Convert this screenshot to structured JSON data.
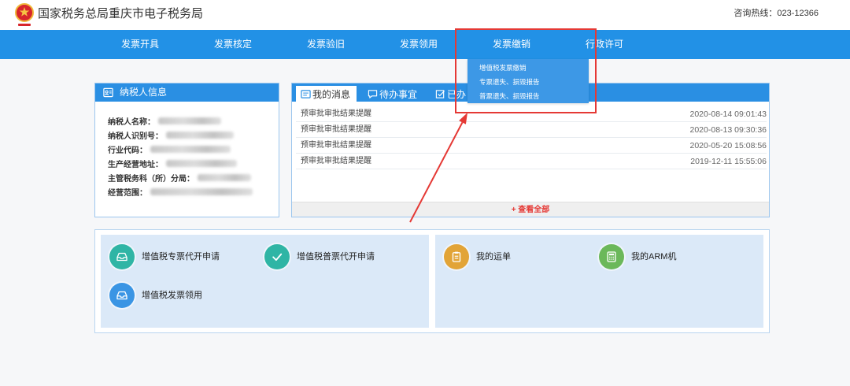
{
  "header": {
    "title": "国家税务总局重庆市电子税务局",
    "hotline": "咨询热线：023-12366",
    "logo_icon": "national-tax-emblem-icon"
  },
  "theme": {
    "nav_blue": "#2291e6",
    "dropdown_blue": "#3d98e6",
    "panel_header_blue": "#2a8fe3",
    "annotation_red": "#e53935",
    "view_all_red": "#e53935",
    "service_box_bg": "#dbe9f8"
  },
  "nav": {
    "items": [
      {
        "label": "发票开具"
      },
      {
        "label": "发票核定"
      },
      {
        "label": "发票验旧"
      },
      {
        "label": "发票领用"
      },
      {
        "label": "发票缴销",
        "active": true
      },
      {
        "label": "行政许可"
      }
    ]
  },
  "dropdown": {
    "items": [
      {
        "label": "增值税发票缴销"
      },
      {
        "label": "专票遗失、损毁报告"
      },
      {
        "label": "普票遗失、损毁报告"
      }
    ]
  },
  "taxpayer_panel": {
    "title": "纳税人信息",
    "icon": "id-card-icon",
    "fields": [
      {
        "label": "纳税人名称："
      },
      {
        "label": "纳税人识别号："
      },
      {
        "label": "行业代码："
      },
      {
        "label": "生产经营地址："
      },
      {
        "label": "主管税务科（所）分局："
      },
      {
        "label": "经营范围："
      }
    ]
  },
  "messages_panel": {
    "tabs": [
      {
        "label": "我的消息",
        "icon": "message-icon",
        "active": true
      },
      {
        "label": "待办事宜",
        "icon": "chat-bubble-icon"
      },
      {
        "label": "已办",
        "icon": "checkbox-icon"
      }
    ],
    "rows": [
      {
        "title": "预审批审批结果提醒",
        "time": "2020-08-14 09:01:43"
      },
      {
        "title": "预审批审批结果提醒",
        "time": "2020-08-13 09:30:36"
      },
      {
        "title": "预审批审批结果提醒",
        "time": "2020-05-20 15:08:56"
      },
      {
        "title": "预审批审批结果提醒",
        "time": "2019-12-11 15:55:06"
      }
    ],
    "view_all": "+ 查看全部"
  },
  "services": {
    "invoice_group": [
      {
        "label": "增值税专票代开申请",
        "icon": "inbox-tray-icon",
        "color": "#2fb5a5"
      },
      {
        "label": "增值税普票代开申请",
        "icon": "checkmark-icon",
        "color": "#2fb5a5"
      },
      {
        "label": "增值税发票领用",
        "icon": "inbox-tray-icon",
        "color": "#3a95e4"
      }
    ],
    "personal_group": [
      {
        "label": "我的运单",
        "icon": "clipboard-icon",
        "color": "#e2a437"
      },
      {
        "label": "我的ARM机",
        "icon": "calculator-icon",
        "color": "#6bb85a"
      }
    ]
  }
}
